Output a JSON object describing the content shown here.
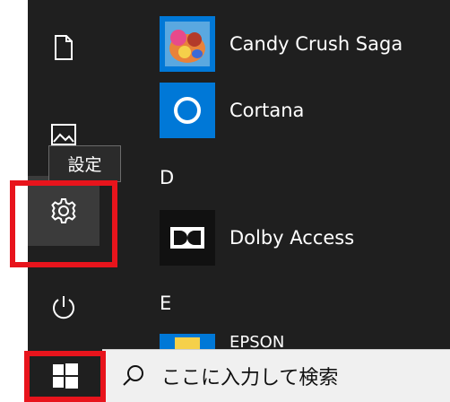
{
  "rail": {
    "settings_tooltip": "設定"
  },
  "apps": [
    {
      "name": "Candy Crush Saga",
      "icon": "candy-crush-icon"
    },
    {
      "name": "Cortana",
      "icon": "cortana-icon"
    },
    {
      "name": "Dolby Access",
      "icon": "dolby-icon"
    },
    {
      "name": "EPSON",
      "icon": "epson-icon"
    }
  ],
  "sections": [
    "D",
    "E"
  ],
  "search": {
    "placeholder": "ここに入力して検索"
  },
  "colors": {
    "menu_bg": "#1f1f1f",
    "tile_blue": "#0078d7",
    "highlight": "#e8141c"
  }
}
